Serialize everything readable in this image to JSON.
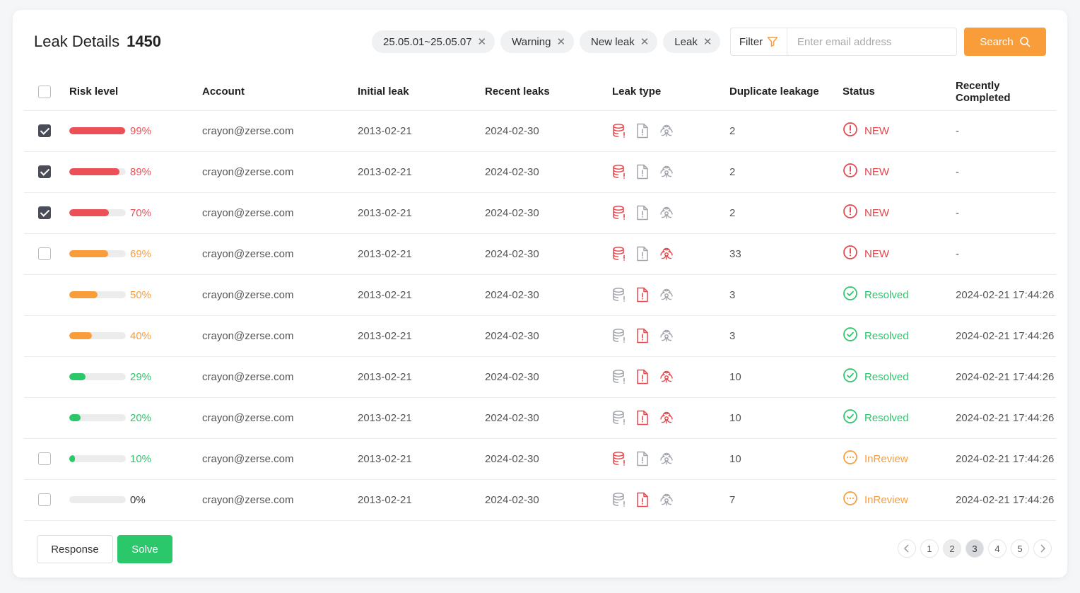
{
  "header": {
    "title": "Leak Details",
    "count": "1450",
    "chips": [
      {
        "label": "25.05.01~25.05.07"
      },
      {
        "label": "Warning"
      },
      {
        "label": "New leak"
      },
      {
        "label": "Leak"
      }
    ],
    "filter_label": "Filter",
    "search_placeholder": "Enter email address",
    "search_label": "Search"
  },
  "table": {
    "columns": [
      "Risk level",
      "Account",
      "Initial leak",
      "Recent leaks",
      "Leak type",
      "Duplicate leakage",
      "Status",
      "Recently Completed"
    ],
    "rows": [
      {
        "checkbox": "checked",
        "risk": 99,
        "risk_label": "99%",
        "level": "high",
        "account": "crayon@zerse.com",
        "initial": "2013-02-21",
        "recent": "2024-02-30",
        "types": [
          true,
          false,
          false
        ],
        "dup": "2",
        "status": "NEW",
        "status_kind": "new",
        "completed": "-"
      },
      {
        "checkbox": "checked",
        "risk": 89,
        "risk_label": "89%",
        "level": "high",
        "account": "crayon@zerse.com",
        "initial": "2013-02-21",
        "recent": "2024-02-30",
        "types": [
          true,
          false,
          false
        ],
        "dup": "2",
        "status": "NEW",
        "status_kind": "new",
        "completed": "-"
      },
      {
        "checkbox": "checked",
        "risk": 70,
        "risk_label": "70%",
        "level": "high",
        "account": "crayon@zerse.com",
        "initial": "2013-02-21",
        "recent": "2024-02-30",
        "types": [
          true,
          false,
          false
        ],
        "dup": "2",
        "status": "NEW",
        "status_kind": "new",
        "completed": "-"
      },
      {
        "checkbox": "unchecked",
        "risk": 69,
        "risk_label": "69%",
        "level": "mid",
        "account": "crayon@zerse.com",
        "initial": "2013-02-21",
        "recent": "2024-02-30",
        "types": [
          true,
          false,
          true
        ],
        "dup": "33",
        "status": "NEW",
        "status_kind": "new",
        "completed": "-"
      },
      {
        "checkbox": "none",
        "risk": 50,
        "risk_label": "50%",
        "level": "mid",
        "account": "crayon@zerse.com",
        "initial": "2013-02-21",
        "recent": "2024-02-30",
        "types": [
          false,
          true,
          false
        ],
        "dup": "3",
        "status": "Resolved",
        "status_kind": "resolved",
        "completed": "2024-02-21 17:44:26"
      },
      {
        "checkbox": "none",
        "risk": 40,
        "risk_label": "40%",
        "level": "mid",
        "account": "crayon@zerse.com",
        "initial": "2013-02-21",
        "recent": "2024-02-30",
        "types": [
          false,
          true,
          false
        ],
        "dup": "3",
        "status": "Resolved",
        "status_kind": "resolved",
        "completed": "2024-02-21 17:44:26"
      },
      {
        "checkbox": "none",
        "risk": 29,
        "risk_label": "29%",
        "level": "low",
        "account": "crayon@zerse.com",
        "initial": "2013-02-21",
        "recent": "2024-02-30",
        "types": [
          false,
          true,
          true
        ],
        "dup": "10",
        "status": "Resolved",
        "status_kind": "resolved",
        "completed": "2024-02-21 17:44:26"
      },
      {
        "checkbox": "none",
        "risk": 20,
        "risk_label": "20%",
        "level": "low",
        "account": "crayon@zerse.com",
        "initial": "2013-02-21",
        "recent": "2024-02-30",
        "types": [
          false,
          true,
          true
        ],
        "dup": "10",
        "status": "Resolved",
        "status_kind": "resolved",
        "completed": "2024-02-21 17:44:26"
      },
      {
        "checkbox": "unchecked",
        "risk": 10,
        "risk_label": "10%",
        "level": "low",
        "account": "crayon@zerse.com",
        "initial": "2013-02-21",
        "recent": "2024-02-30",
        "types": [
          true,
          false,
          false
        ],
        "dup": "10",
        "status": "InReview",
        "status_kind": "review",
        "completed": "2024-02-21 17:44:26"
      },
      {
        "checkbox": "unchecked",
        "risk": 0,
        "risk_label": "0%",
        "level": "none",
        "account": "crayon@zerse.com",
        "initial": "2013-02-21",
        "recent": "2024-02-30",
        "types": [
          false,
          true,
          false
        ],
        "dup": "7",
        "status": "InReview",
        "status_kind": "review",
        "completed": "2024-02-21 17:44:26"
      }
    ]
  },
  "footer": {
    "response_label": "Response",
    "solve_label": "Solve",
    "pages": [
      "1",
      "2",
      "3",
      "4",
      "5"
    ],
    "current_page": "3"
  },
  "colors": {
    "high": "#ec4f55",
    "mid": "#f99d3b",
    "low": "#2bc76b",
    "none": "#333333",
    "icon_active": "#e5474c",
    "icon_inactive": "#a0a4ab",
    "new": "#e5474c",
    "resolved": "#2bc76b",
    "review": "#f99d3b",
    "accent": "#f99d3b"
  },
  "icons": {
    "leak_types": [
      "database-icon",
      "file-alert-icon",
      "biohazard-icon"
    ],
    "status": {
      "new": "alert-circle-icon",
      "resolved": "check-circle-icon",
      "review": "more-circle-icon"
    }
  }
}
